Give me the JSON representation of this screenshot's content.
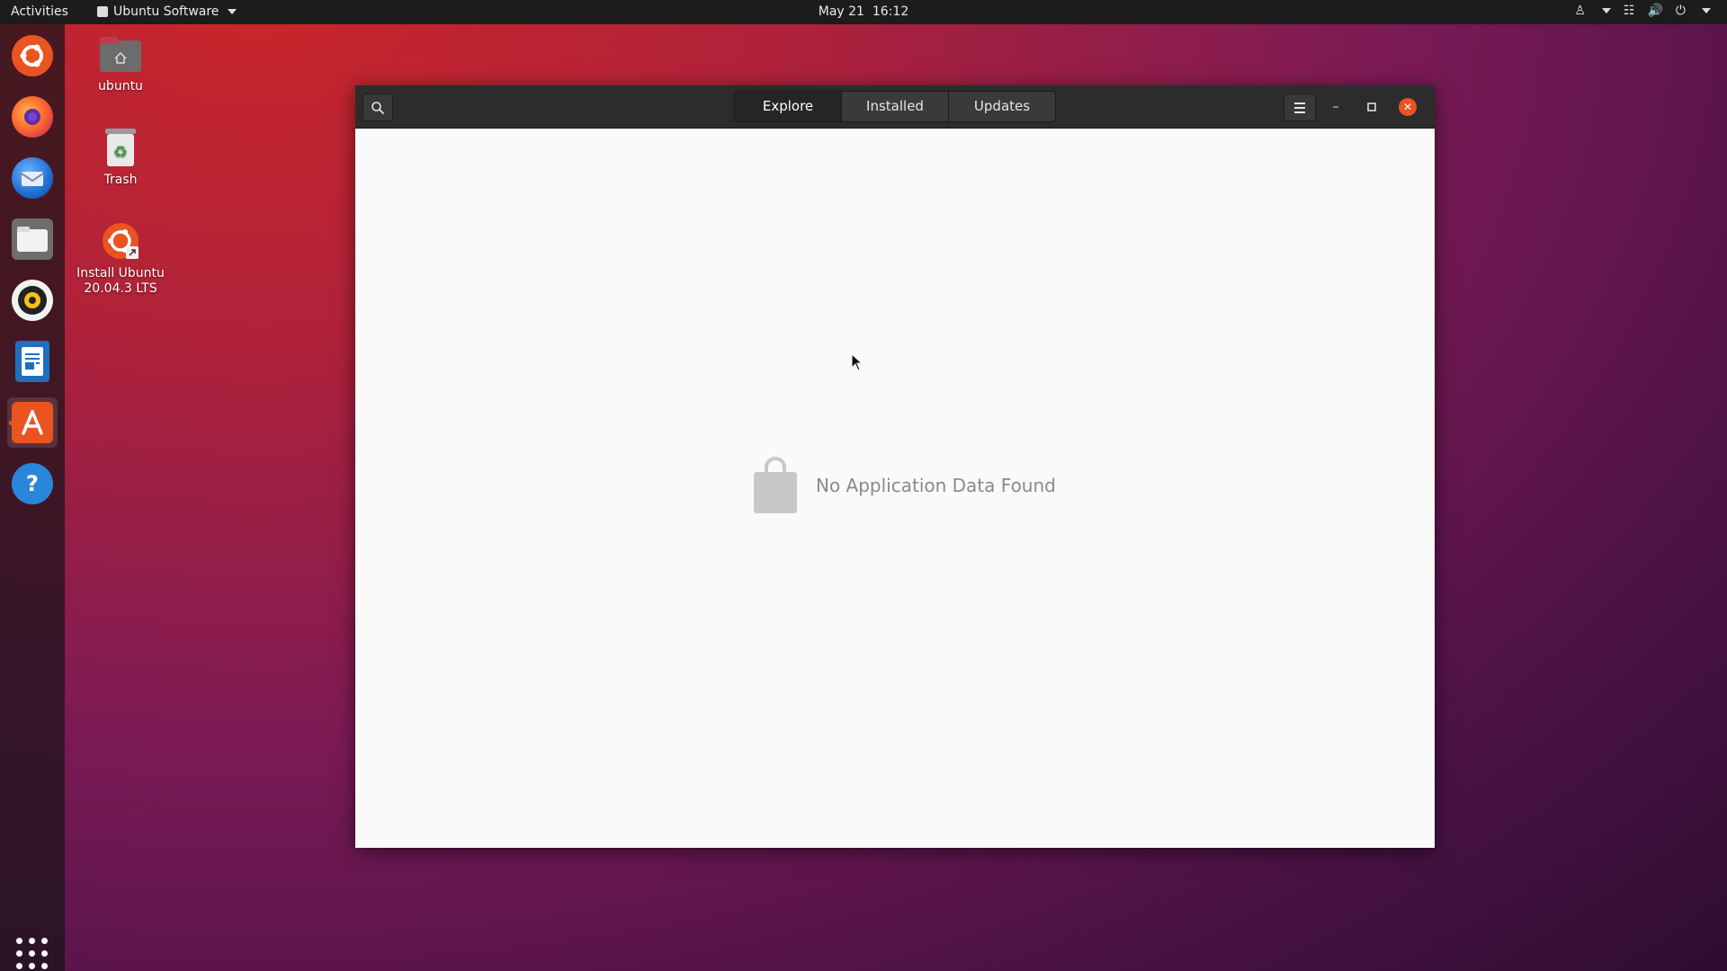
{
  "topbar": {
    "activities": "Activities",
    "app_name": "Ubuntu Software",
    "date": "May 21",
    "time": "16:12"
  },
  "dock": {
    "items": [
      {
        "name": "ubuntu-installer-icon"
      },
      {
        "name": "firefox-icon"
      },
      {
        "name": "thunderbird-icon"
      },
      {
        "name": "files-icon"
      },
      {
        "name": "rhythmbox-icon"
      },
      {
        "name": "libreoffice-writer-icon"
      },
      {
        "name": "ubuntu-software-icon",
        "active": true
      },
      {
        "name": "help-icon"
      }
    ]
  },
  "desktop": {
    "icons": [
      {
        "label": "ubuntu"
      },
      {
        "label": "Trash"
      },
      {
        "label": "Install Ubuntu 20.04.3 LTS"
      }
    ]
  },
  "window": {
    "tabs": [
      {
        "label": "Explore",
        "active": true
      },
      {
        "label": "Installed"
      },
      {
        "label": "Updates"
      }
    ],
    "empty_message": "No Application Data Found"
  },
  "colors": {
    "accent": "#e95420",
    "headerbar": "#2c2c2c",
    "content_bg": "#fafafa"
  }
}
